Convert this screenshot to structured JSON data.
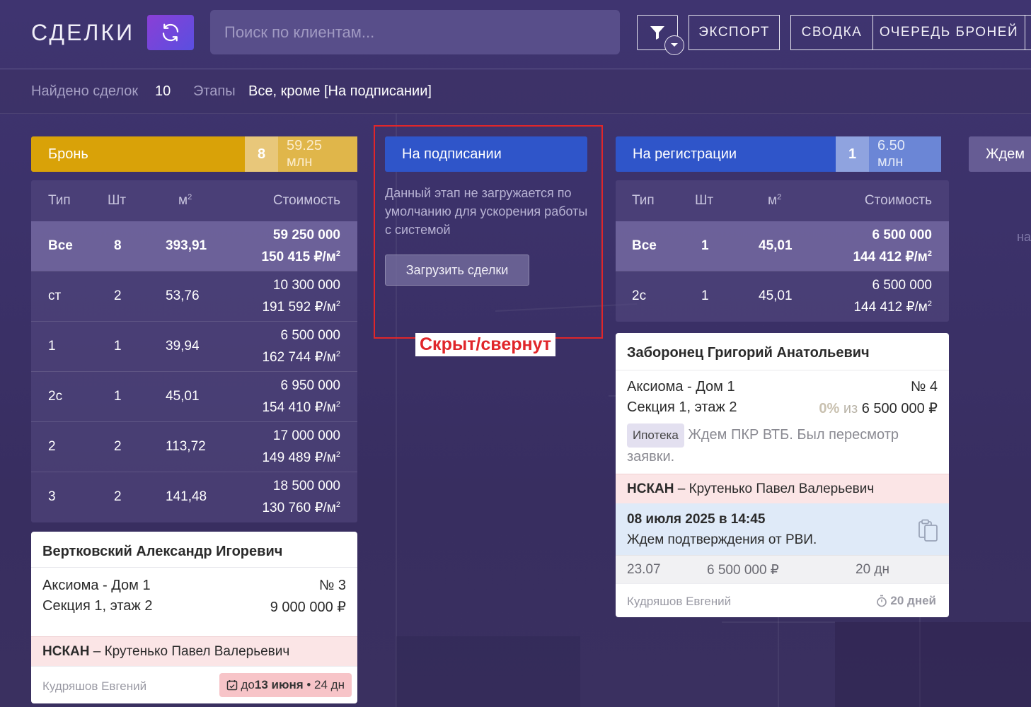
{
  "header": {
    "title": "СДЕЛКИ",
    "search_placeholder": "Поиск по клиентам...",
    "buttons": {
      "export": "ЭКСПОРТ",
      "summary": "СВОДКА",
      "queue": "ОЧЕРЕДЬ БРОНЕЙ"
    }
  },
  "subheader": {
    "found_label": "Найдено сделок",
    "found_value": "10",
    "stages_label": "Этапы",
    "stages_value": "Все, кроме [На подписании]"
  },
  "columns": {
    "type": "Тип",
    "qty": "Шт",
    "area": "м",
    "area_sup": "2",
    "cost": "Стоимость"
  },
  "stages": {
    "bron": {
      "name": "Бронь",
      "count": "8",
      "sum": "59.25 млн",
      "color": "#d9a208",
      "rows": [
        {
          "type": "Все",
          "qty": "8",
          "area": "393,91",
          "price": "59 250 000",
          "per_m": "150 415 ₽/м",
          "all": true
        },
        {
          "type": "ст",
          "qty": "2",
          "area": "53,76",
          "price": "10 300 000",
          "per_m": "191 592 ₽/м"
        },
        {
          "type": "1",
          "qty": "1",
          "area": "39,94",
          "price": "6 500 000",
          "per_m": "162 744 ₽/м"
        },
        {
          "type": "2с",
          "qty": "1",
          "area": "45,01",
          "price": "6 950 000",
          "per_m": "154 410 ₽/м"
        },
        {
          "type": "2",
          "qty": "2",
          "area": "113,72",
          "price": "17 000 000",
          "per_m": "149 489 ₽/м"
        },
        {
          "type": "3",
          "qty": "2",
          "area": "141,48",
          "price": "18 500 000",
          "per_m": "130 760 ₽/м"
        }
      ],
      "card": {
        "client": "Вертковский Александр Игоревич",
        "project": "Аксиома - Дом 1",
        "number": "№ 3",
        "section": "Секция 1, этаж 2",
        "price": "9 000 000 ₽",
        "nskan_bold": "НСКАН",
        "nskan_rest": " – Крутенько Павел Валерьевич",
        "manager": "Кудряшов Евгений",
        "due_prefix": "до ",
        "due_date": "13 июня",
        "due_days": " • 24 дн"
      }
    },
    "signing": {
      "name": "На подписании",
      "color": "#2f55c9",
      "message": "Данный этап не загружается по умолчанию для ускорения работы с системой",
      "load_button": "Загрузить сделки",
      "annotation": "Скрыт/свернут"
    },
    "registration": {
      "name": "На регистрации",
      "count": "1",
      "sum": "6.50 млн",
      "color": "#2f55c9",
      "rows": [
        {
          "type": "Все",
          "qty": "1",
          "area": "45,01",
          "price": "6 500 000",
          "per_m": "144 412 ₽/м",
          "all": true
        },
        {
          "type": "2с",
          "qty": "1",
          "area": "45,01",
          "price": "6 500 000",
          "per_m": "144 412 ₽/м"
        }
      ],
      "card": {
        "client": "Заборонец Григорий Анатольевич",
        "project": "Аксиома - Дом 1",
        "number": "№ 4",
        "section": "Секция 1, этаж 2",
        "paid_pct": "0%",
        "paid_of": " из ",
        "price": "6 500 000 ₽",
        "badge": "Ипотека",
        "note": "Ждем ПКР ВТБ. Был пересмотр заявки.",
        "nskan_bold": "НСКАН",
        "nskan_rest": " – Крутенько Павел Валерьевич",
        "event_date": "08 июля 2025 в 14:45",
        "event_text": "Ждем подтверждения от РВИ.",
        "stat_date": "23.07",
        "stat_price": "6 500 000 ₽",
        "stat_days": "20 дн",
        "manager": "Кудряшов Евгений",
        "timer": "20 дней"
      }
    },
    "waiting": {
      "name": "Ждем",
      "partial": "на"
    }
  }
}
